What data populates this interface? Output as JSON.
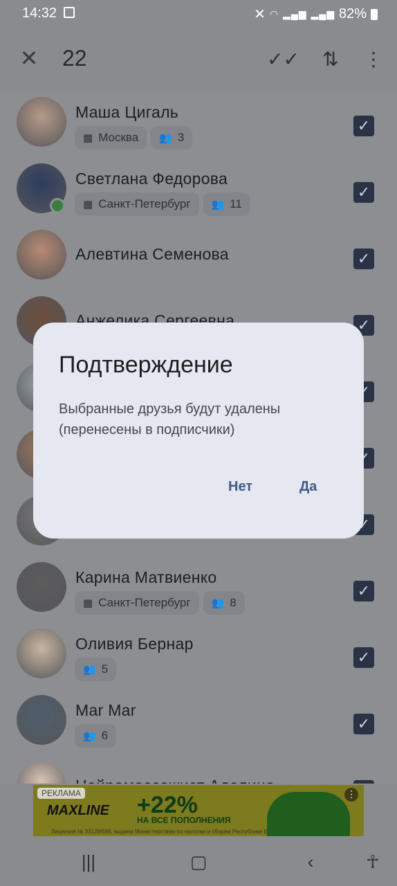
{
  "status_bar": {
    "time": "14:32",
    "battery": "82%",
    "icons": [
      "image-icon",
      "mute-icon",
      "wifi-icon",
      "signal-icon",
      "signal-icon",
      "battery-icon"
    ]
  },
  "toolbar": {
    "count": "22",
    "icons": [
      "close-icon",
      "double-check-icon",
      "sort-icon",
      "more-vert-icon"
    ]
  },
  "friends": [
    {
      "name": "Маша Цигаль",
      "city": "Москва",
      "mutual": "3",
      "checked": true,
      "online": false,
      "avatar_color": "#b69a88"
    },
    {
      "name": "Светлана Федорова",
      "city": "Санкт-Петербург",
      "mutual": "11",
      "checked": true,
      "online": true,
      "avatar_color": "#2e3c5e"
    },
    {
      "name": "Алевтина Семенова",
      "city": "",
      "mutual": "",
      "checked": true,
      "online": false,
      "avatar_color": "#b88a72"
    },
    {
      "name": "Анжелика Сергеевна",
      "city": "",
      "mutual": "",
      "checked": true,
      "online": false,
      "avatar_color": "#6b4e3c"
    },
    {
      "name": "",
      "city": "",
      "mutual": "",
      "checked": true,
      "online": false,
      "avatar_color": "#9aa4a8"
    },
    {
      "name": "",
      "city": "",
      "mutual": "",
      "checked": true,
      "online": false,
      "avatar_color": "#9a7660"
    },
    {
      "name": "",
      "city": "",
      "mutual": "",
      "checked": true,
      "online": false,
      "avatar_color": "#777777"
    },
    {
      "name": "Карина Матвиенко",
      "city": "Санкт-Петербург",
      "mutual": "8",
      "checked": true,
      "online": false,
      "avatar_color": "#5c5c5c"
    },
    {
      "name": "Оливия Бернар",
      "city": "",
      "mutual": "5",
      "checked": true,
      "online": false,
      "avatar_color": "#c7b5a0"
    },
    {
      "name": "Mar Mar",
      "city": "",
      "mutual": "6",
      "checked": true,
      "online": false,
      "avatar_color": "#4e5e6c"
    },
    {
      "name": "Нейромассажист Аделина",
      "city": "",
      "mutual": "",
      "checked": true,
      "online": false,
      "avatar_color": "#d8c4b4"
    }
  ],
  "ad": {
    "tag": "РЕКЛАМА",
    "brand": "MAXLINE",
    "promo": "+22%",
    "promo_sub": "НА ВСЕ ПОПОЛНЕНИЯ",
    "legal": "Лицензия № 33128/596, выдана Министерством по налогам и сборам Республики Б..."
  },
  "dialog": {
    "title": "Подтверждение",
    "message": "Выбранные друзья будут удалены (перенесены в подписчики)",
    "no_label": "Нет",
    "yes_label": "Да"
  },
  "navbar": {
    "icons": [
      "recents-icon",
      "home-icon",
      "back-icon",
      "accessibility-icon"
    ]
  }
}
